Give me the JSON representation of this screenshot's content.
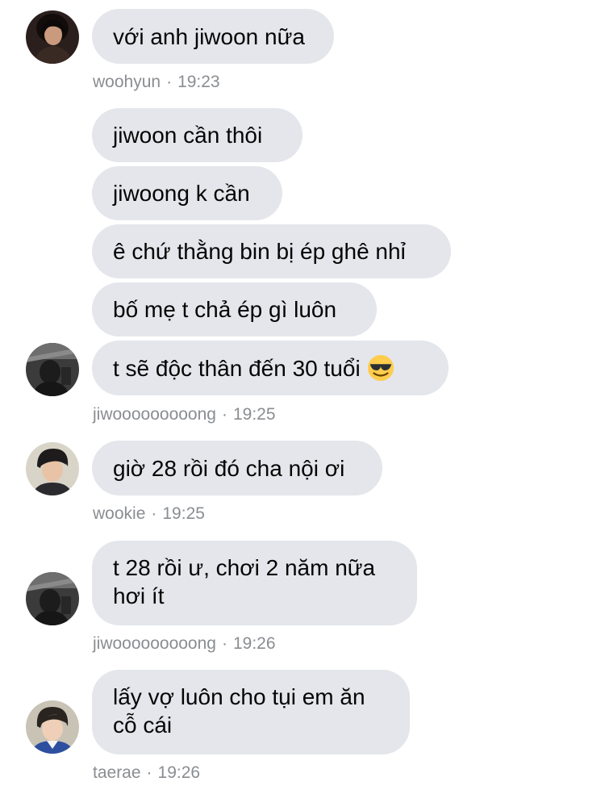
{
  "groups": [
    {
      "sender": "woohyun",
      "time": "19:23",
      "messages": [
        "với anh jiwoon nữa"
      ]
    },
    {
      "sender": "jiwooooooooong",
      "time": "19:25",
      "messages": [
        "jiwoon cần thôi",
        "jiwoong k cần",
        "ê chứ thằng bin bị ép ghê nhỉ",
        "bố mẹ t chả ép gì luôn",
        "t sẽ độc thân đến 30 tuổi"
      ],
      "last_message_emoji": "smiling-face-with-sunglasses"
    },
    {
      "sender": "wookie",
      "time": "19:25",
      "messages": [
        "giờ 28 rồi đó cha nội ơi"
      ]
    },
    {
      "sender": "jiwooooooooong",
      "time": "19:26",
      "messages": [
        "t 28 rồi ư, chơi 2 năm nữa\nhơi ít"
      ]
    },
    {
      "sender": "taerae",
      "time": "19:26",
      "messages": [
        "lấy vợ luôn cho tụi em ăn\ncỗ cái"
      ]
    }
  ],
  "meta_separator": "·",
  "colors": {
    "bubble": "#e4e6eb",
    "text": "#050505",
    "meta": "#8a8d91",
    "background": "#ffffff"
  }
}
